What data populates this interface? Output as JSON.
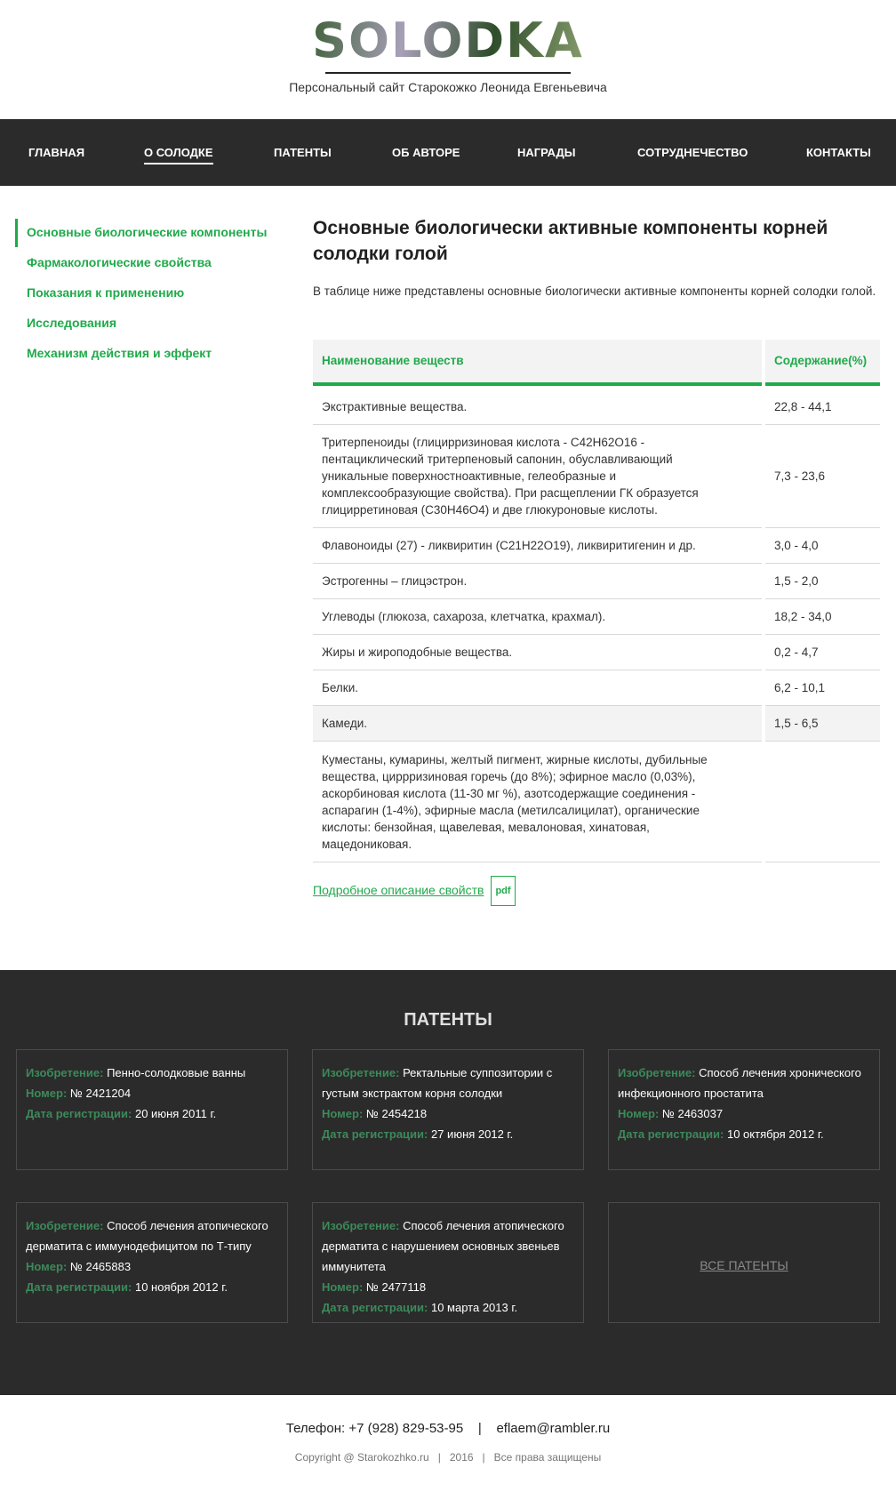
{
  "header": {
    "logo_text": "SOLODKA",
    "tagline": "Персональный сайт Старокожко Леонида Евгеньевича"
  },
  "nav": {
    "items": [
      {
        "label": "ГЛАВНАЯ"
      },
      {
        "label": "О СОЛОДКЕ",
        "active": true
      },
      {
        "label": "ПАТЕНТЫ"
      },
      {
        "label": "ОБ АВТОРЕ"
      },
      {
        "label": "НАГРАДЫ"
      },
      {
        "label": "СОТРУДНЕЧЕСТВО"
      },
      {
        "label": "КОНТАКТЫ"
      }
    ]
  },
  "sidebar": {
    "items": [
      {
        "label": "Основные биологические компоненты",
        "active": true
      },
      {
        "label": "Фармакологические свойства"
      },
      {
        "label": "Показания к применению"
      },
      {
        "label": "Исследования"
      },
      {
        "label": "Механизм действия и эффект"
      }
    ]
  },
  "main": {
    "title": "Основные биологически активные компоненты корней солодки голой",
    "intro": "В таблице ниже представлены основные биологически активные компоненты корней солодки голой.",
    "table": {
      "headers": [
        "Наименование веществ",
        "Содержание(%)"
      ],
      "rows": [
        {
          "name": "Экстрактивные вещества.",
          "value": "22,8 - 44,1"
        },
        {
          "name": "Тритерпеноиды (глицирризиновая кислота - C42H62O16 - пентациклический тритерпеновый сапонин, обуславливающий уникальные поверхностноактивные, гелеобразные и комплексообразующие свойства). При расщеплении ГК образуется глицирретиновая (C30H46O4) и две глюкуроновые кислоты.",
          "value": "7,3 - 23,6"
        },
        {
          "name": "Флавоноиды (27) - ликвиритин (C21H22O19), ликвиритигенин и др.",
          "value": "3,0 - 4,0"
        },
        {
          "name": "Эстрогенны – глицэстрон.",
          "value": "1,5 - 2,0"
        },
        {
          "name": "Углеводы (глюкоза, сахароза, клетчатка, крахмал).",
          "value": "18,2 - 34,0"
        },
        {
          "name": "Жиры и жироподобные вещества.",
          "value": "0,2 - 4,7"
        },
        {
          "name": "Белки.",
          "value": "6,2 - 10,1"
        },
        {
          "name": "Камеди.",
          "value": "1,5 - 6,5"
        },
        {
          "name": "Куместаны, кумарины, желтый пигмент, жирные кислоты, дубильные вещества, циррризиновая горечь (до 8%); эфирное масло (0,03%), аскорбиновая кислота (11-30 мг %), азотсодержащие соединения - аспарагин (1-4%), эфирные масла (метилсалицилат), органические кислоты: бензойная, щавелевая, мевалоновая, хинатовая, мацедониковая.",
          "value": ""
        }
      ]
    },
    "pdf_link_text": "Подробное описание свойств",
    "pdf_icon_text": "pdf"
  },
  "patents": {
    "title": "ПАТЕНТЫ",
    "labels": {
      "invention": "Изобретение:",
      "number": "Номер:",
      "date": "Дата регистрации:"
    },
    "cards": [
      {
        "invention": "Пенно-солодковые ванны",
        "number": "№ 2421204",
        "date": "20 июня 2011 г."
      },
      {
        "invention": "Ректальные суппозитории с густым экстрактом корня солодки",
        "number": "№ 2454218",
        "date": "27 июня 2012 г."
      },
      {
        "invention": "Способ лечения хронического инфекционного простатита",
        "number": "№ 2463037",
        "date": "10 октября 2012 г."
      },
      {
        "invention": "Способ лечения атопического дерматита с иммунодефицитом по Т-типу",
        "number": "№ 2465883",
        "date": "10 ноября 2012 г."
      },
      {
        "invention": "Способ лечения атопического дерматита с нарушением основных звеньев иммунитета",
        "number": "№ 2477118",
        "date": "10 марта 2013 г."
      }
    ],
    "all_link": "ВСЕ ПАТЕНТЫ"
  },
  "footer": {
    "phone_label": "Телефон:",
    "phone": "+7 (928) 829-53-95",
    "separator": "|",
    "email": "eflaem@rambler.ru",
    "copyright": "Copyright @ Starokozhko.ru",
    "year": "2016",
    "rights": "Все права защищены"
  },
  "colors": {
    "accent": "#1faa4a",
    "dark": "#2b2b2b"
  }
}
